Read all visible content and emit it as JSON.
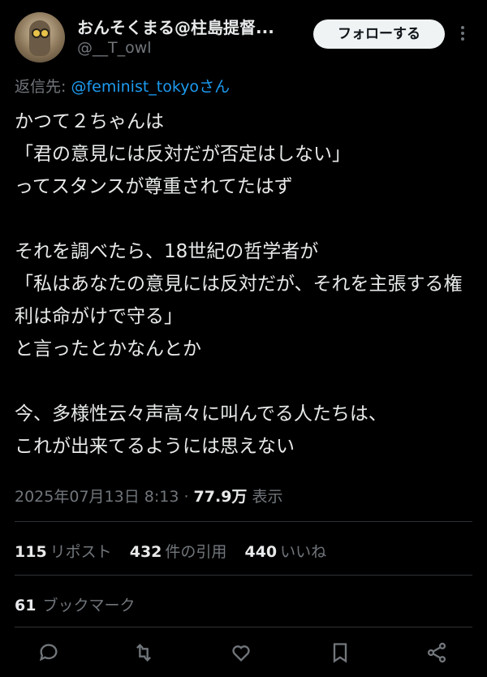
{
  "author": {
    "display_name": "おんそくまる@柱島提督...",
    "handle": "@__T_owl",
    "follow_label": "フォローする"
  },
  "reply": {
    "prefix": "返信先: ",
    "mention": "@feminist_tokyo",
    "suffix": "さん"
  },
  "tweet": {
    "text": "かつて２ちゃんは\n「君の意見には反対だが否定はしない」\nってスタンスが尊重されてたはず\n\nそれを調べたら、18世紀の哲学者が\n「私はあなたの意見には反対だが、それを主張する権利は命がけで守る」\nと言ったとかなんとか\n\n今、多様性云々声高々に叫んでる人たちは、\nこれが出来てるようには思えない"
  },
  "meta": {
    "timestamp": "2025年07月13日 8:13 · ",
    "views_count": "77.9万",
    "views_label": " 表示"
  },
  "stats": {
    "reposts": "115",
    "reposts_label": "リポスト",
    "quotes": "432",
    "quotes_label": "件の引用",
    "likes": "440",
    "likes_label": "いいね"
  },
  "bookmarks": {
    "count": "61",
    "label": "ブックマーク"
  },
  "actions": [
    "reply-icon",
    "retweet-icon",
    "like-icon",
    "bookmark-icon",
    "share-icon"
  ],
  "colors": {
    "background": "#000000",
    "text": "#e7e9ea",
    "secondary": "#71767b",
    "link": "#1d9bf0",
    "divider": "#2f3336"
  }
}
